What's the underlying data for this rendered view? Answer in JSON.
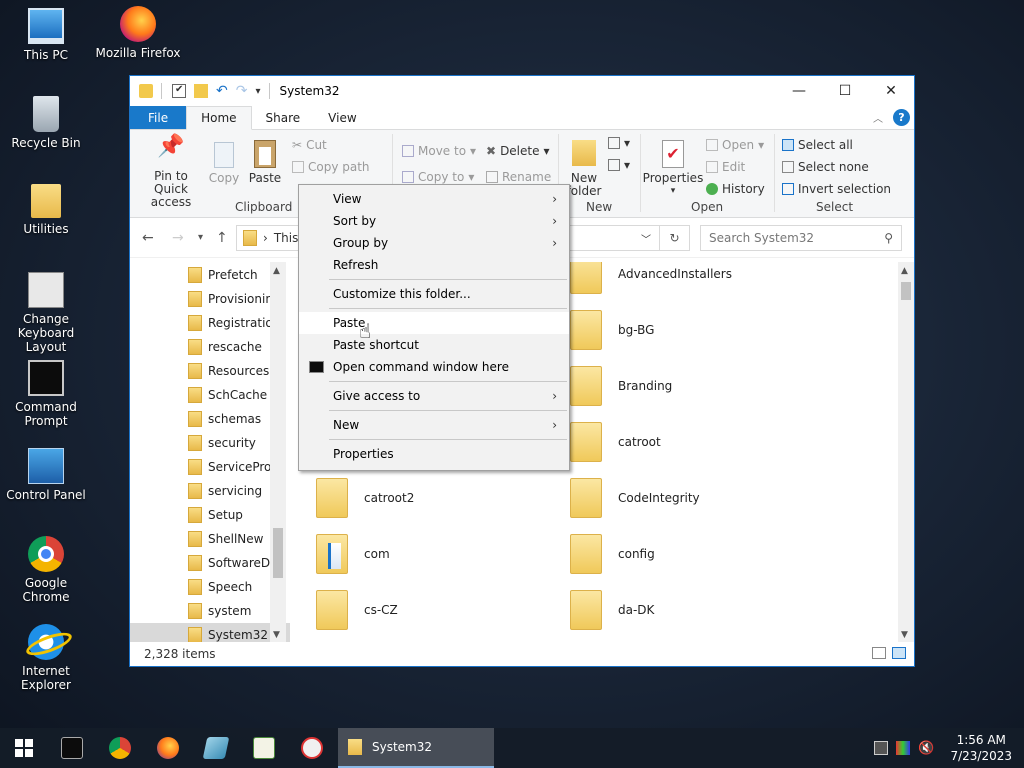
{
  "desktop": {
    "icons": [
      {
        "label": "This PC",
        "icon": "computer-icon"
      },
      {
        "label": "Mozilla Firefox",
        "icon": "firefox-icon"
      },
      {
        "label": "Recycle Bin",
        "icon": "recycle-bin-icon"
      },
      {
        "label": "Utilities",
        "icon": "folder-icon"
      },
      {
        "label": "Change Keyboard Layout",
        "icon": "keyboard-icon"
      },
      {
        "label": "Command Prompt",
        "icon": "cmd-icon"
      },
      {
        "label": "Control Panel",
        "icon": "control-panel-icon"
      },
      {
        "label": "Google Chrome",
        "icon": "chrome-icon"
      },
      {
        "label": "Internet Explorer",
        "icon": "ie-icon"
      }
    ]
  },
  "window": {
    "title": "System32",
    "tabs": {
      "file": "File",
      "home": "Home",
      "share": "Share",
      "view": "View"
    },
    "ribbon": {
      "pin_to_quick_access": "Pin to Quick access",
      "copy": "Copy",
      "paste": "Paste",
      "cut": "Cut",
      "copy_path": "Copy path",
      "clipboard": "Clipboard",
      "move_to": "Move to",
      "copy_to": "Copy to",
      "delete": "Delete",
      "rename": "Rename",
      "new_folder": "New folder",
      "new": "New",
      "properties": "Properties",
      "open_btn": "Open",
      "edit": "Edit",
      "history": "History",
      "open_group": "Open",
      "select_all": "Select all",
      "select_none": "Select none",
      "invert_selection": "Invert selection",
      "select_group": "Select"
    },
    "address": {
      "path_text": "This",
      "search_placeholder": "Search System32"
    },
    "nav_items": [
      "Prefetch",
      "Provisioning",
      "Registration",
      "rescache",
      "Resources",
      "SchCache",
      "schemas",
      "security",
      "ServiceProfi",
      "servicing",
      "Setup",
      "ShellNew",
      "SoftwareDis",
      "Speech",
      "system",
      "System32"
    ],
    "files": {
      "col1": [
        "catroot2",
        "com",
        "cs-CZ"
      ],
      "col2": [
        "AdvancedInstallers",
        "bg-BG",
        "Branding",
        "catroot",
        "CodeIntegrity",
        "config",
        "da-DK"
      ]
    },
    "status": {
      "item_count": "2,328 items"
    }
  },
  "context_menu": {
    "view": "View",
    "sort_by": "Sort by",
    "group_by": "Group by",
    "refresh": "Refresh",
    "customize": "Customize this folder...",
    "paste": "Paste",
    "paste_shortcut": "Paste shortcut",
    "open_cmd": "Open command window here",
    "give_access": "Give access to",
    "new": "New",
    "properties": "Properties"
  },
  "taskbar": {
    "active_task": "System32",
    "time": "1:56 AM",
    "date": "7/23/2023"
  }
}
